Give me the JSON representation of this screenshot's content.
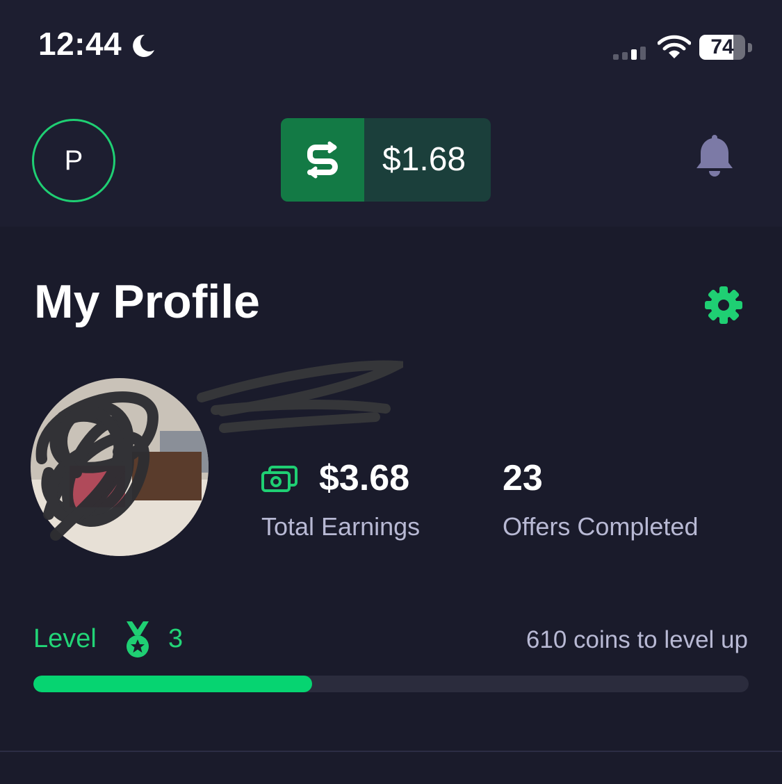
{
  "status_bar": {
    "time": "12:44",
    "battery_level": "74",
    "icons": [
      "moon-icon",
      "cellular-signal-icon",
      "wifi-icon",
      "battery-icon"
    ]
  },
  "header": {
    "avatar_initial": "P",
    "balance": "$1.68",
    "icons": [
      "coin-exchange-icon",
      "bell-icon"
    ]
  },
  "profile": {
    "title": "My Profile",
    "stats": {
      "earnings_value": "$3.68",
      "earnings_label": "Total Earnings",
      "offers_value": "23",
      "offers_label": "Offers Completed"
    },
    "level": {
      "label": "Level",
      "number": "3",
      "coins_to_level_up": "610 coins to level up",
      "progress_fraction": 0.39
    }
  },
  "colors": {
    "background": "#1a1b2b",
    "header_background": "#1d1e30",
    "accent_green": "#06d471",
    "balance_coin_bg": "#137a45",
    "balance_bg": "#1b3f3b",
    "muted_text": "#b8b9d4",
    "bell": "#7c7aa6"
  }
}
